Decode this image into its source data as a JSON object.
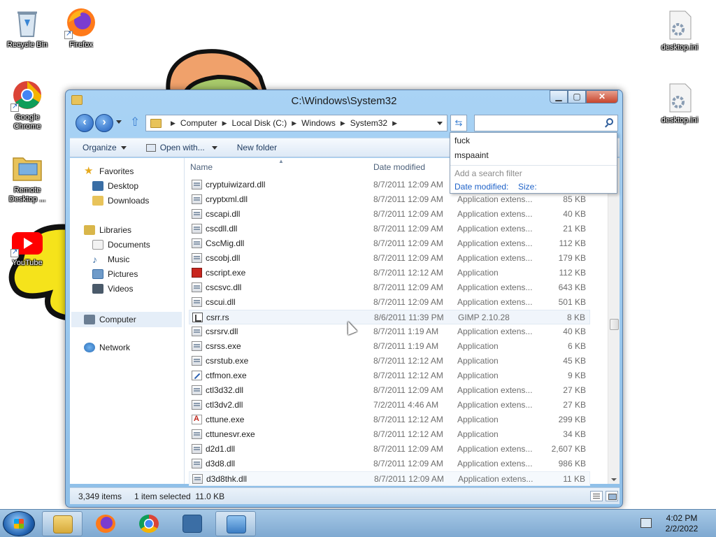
{
  "desktop": {
    "icons": [
      {
        "label": "Recycle Bin"
      },
      {
        "label": "Firefox"
      },
      {
        "label": "Google Chrome"
      },
      {
        "label": "Remote Desktop ..."
      },
      {
        "label": "YouTube"
      },
      {
        "label": "desktop.ini"
      },
      {
        "label": "desktop.ini"
      }
    ]
  },
  "window": {
    "title": "C:\\Windows\\System32",
    "buttons": {
      "minimize": "▁",
      "maximize": "▢",
      "close": "✕"
    },
    "breadcrumb": [
      "Computer",
      "Local Disk (C:)",
      "Windows",
      "System32"
    ],
    "search": {
      "value": "",
      "placeholder": ""
    }
  },
  "toolbar": {
    "organize": "Organize",
    "open_with": "Open with...",
    "new_folder": "New folder"
  },
  "nav_pane": {
    "favorites": "Favorites",
    "desktop": "Desktop",
    "downloads": "Downloads",
    "libraries": "Libraries",
    "documents": "Documents",
    "music": "Music",
    "pictures": "Pictures",
    "videos": "Videos",
    "computer": "Computer",
    "network": "Network"
  },
  "columns": {
    "name": "Name",
    "date": "Date modified"
  },
  "files": [
    {
      "name": "cryptuiwizard.dll",
      "date": "8/7/2011 12:09 AM",
      "type": "",
      "size": ""
    },
    {
      "name": "cryptxml.dll",
      "date": "8/7/2011 12:09 AM",
      "type": "Application extens...",
      "size": "85 KB"
    },
    {
      "name": "cscapi.dll",
      "date": "8/7/2011 12:09 AM",
      "type": "Application extens...",
      "size": "40 KB"
    },
    {
      "name": "cscdll.dll",
      "date": "8/7/2011 12:09 AM",
      "type": "Application extens...",
      "size": "21 KB"
    },
    {
      "name": "CscMig.dll",
      "date": "8/7/2011 12:09 AM",
      "type": "Application extens...",
      "size": "112 KB"
    },
    {
      "name": "cscobj.dll",
      "date": "8/7/2011 12:09 AM",
      "type": "Application extens...",
      "size": "179 KB"
    },
    {
      "name": "cscript.exe",
      "date": "8/7/2011 12:12 AM",
      "type": "Application",
      "size": "112 KB"
    },
    {
      "name": "cscsvc.dll",
      "date": "8/7/2011 12:09 AM",
      "type": "Application extens...",
      "size": "643 KB"
    },
    {
      "name": "cscui.dll",
      "date": "8/7/2011 12:09 AM",
      "type": "Application extens...",
      "size": "501 KB"
    },
    {
      "name": "csrr.rs",
      "date": "8/6/2011 11:39 PM",
      "type": "GIMP 2.10.28",
      "size": "8 KB"
    },
    {
      "name": "csrsrv.dll",
      "date": "8/7/2011 1:19 AM",
      "type": "Application extens...",
      "size": "40 KB"
    },
    {
      "name": "csrss.exe",
      "date": "8/7/2011 1:19 AM",
      "type": "Application",
      "size": "6 KB"
    },
    {
      "name": "csrstub.exe",
      "date": "8/7/2011 12:12 AM",
      "type": "Application",
      "size": "45 KB"
    },
    {
      "name": "ctfmon.exe",
      "date": "8/7/2011 12:12 AM",
      "type": "Application",
      "size": "9 KB"
    },
    {
      "name": "ctl3d32.dll",
      "date": "8/7/2011 12:09 AM",
      "type": "Application extens...",
      "size": "27 KB"
    },
    {
      "name": "ctl3dv2.dll",
      "date": "7/2/2011 4:46 AM",
      "type": "Application extens...",
      "size": "27 KB"
    },
    {
      "name": "cttune.exe",
      "date": "8/7/2011 12:12 AM",
      "type": "Application",
      "size": "299 KB"
    },
    {
      "name": "cttunesvr.exe",
      "date": "8/7/2011 12:12 AM",
      "type": "Application",
      "size": "34 KB"
    },
    {
      "name": "d2d1.dll",
      "date": "8/7/2011 12:09 AM",
      "type": "Application extens...",
      "size": "2,607 KB"
    },
    {
      "name": "d3d8.dll",
      "date": "8/7/2011 12:09 AM",
      "type": "Application extens...",
      "size": "986 KB"
    },
    {
      "name": "d3d8thk.dll",
      "date": "8/7/2011 12:09 AM",
      "type": "Application extens...",
      "size": "11 KB"
    }
  ],
  "search_dropdown": {
    "suggestions": [
      "fuck",
      "mspaaint"
    ],
    "hint": "Add a search filter",
    "filter_date": "Date modified:",
    "filter_size": "Size:"
  },
  "status": {
    "count": "3,349 items",
    "selection": "1 item selected  11.0 KB"
  },
  "clock": {
    "time": "4:02 PM",
    "date": "2/2/2022"
  }
}
